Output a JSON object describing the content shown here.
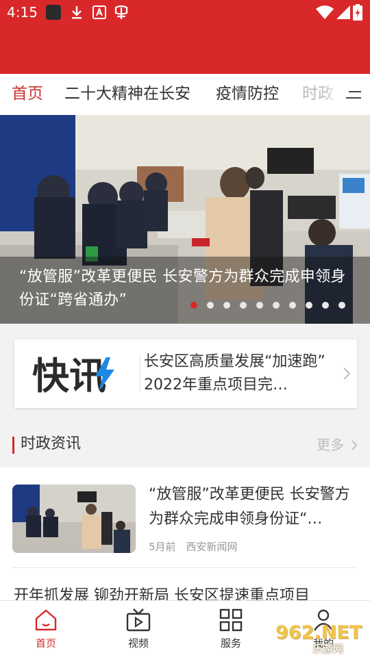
{
  "status_bar": {
    "time": "4:15",
    "icons": [
      "app-square-icon",
      "download-icon",
      "text-a-icon",
      "bug-icon",
      "wifi-icon",
      "signal-icon",
      "battery-icon"
    ]
  },
  "colors": {
    "header_red": "#d8282a",
    "accent": "#c9302c",
    "page_bg": "#f2f2f2"
  },
  "tabs": [
    {
      "label": "首页",
      "active": true
    },
    {
      "label": "二十大精神在长安",
      "active": false
    },
    {
      "label": "疫情防控",
      "active": false
    },
    {
      "label": "时政",
      "active": false
    }
  ],
  "tab_menu_icon": "menu-icon",
  "banner": {
    "caption": "“放管服”改革更便民  长安警方为群众完成申领身份证“跨省通办”",
    "slide_count": 10,
    "active_index": 0
  },
  "flash": {
    "logo": "快讯",
    "text": "长安区高质量发展“加速跑” 2022年重点项目完…"
  },
  "section": {
    "title": "时政资讯",
    "more": "更多"
  },
  "news": [
    {
      "title": "“放管服”改革更便民  长安警方为群众完成申领身份证“…",
      "time": "5月前",
      "source": "西安新闻网"
    },
    {
      "title": "开年抓发展  铆劲开新局  长安区提速重点项目"
    }
  ],
  "bottom_nav": [
    {
      "label": "首页",
      "icon": "home-icon",
      "active": true
    },
    {
      "label": "视频",
      "icon": "video-icon",
      "active": false
    },
    {
      "label": "服务",
      "icon": "grid-icon",
      "active": false
    },
    {
      "label": "我的",
      "icon": "user-icon",
      "active": false
    }
  ],
  "watermark": {
    "text": "962.NET",
    "sub": "乐游网"
  }
}
